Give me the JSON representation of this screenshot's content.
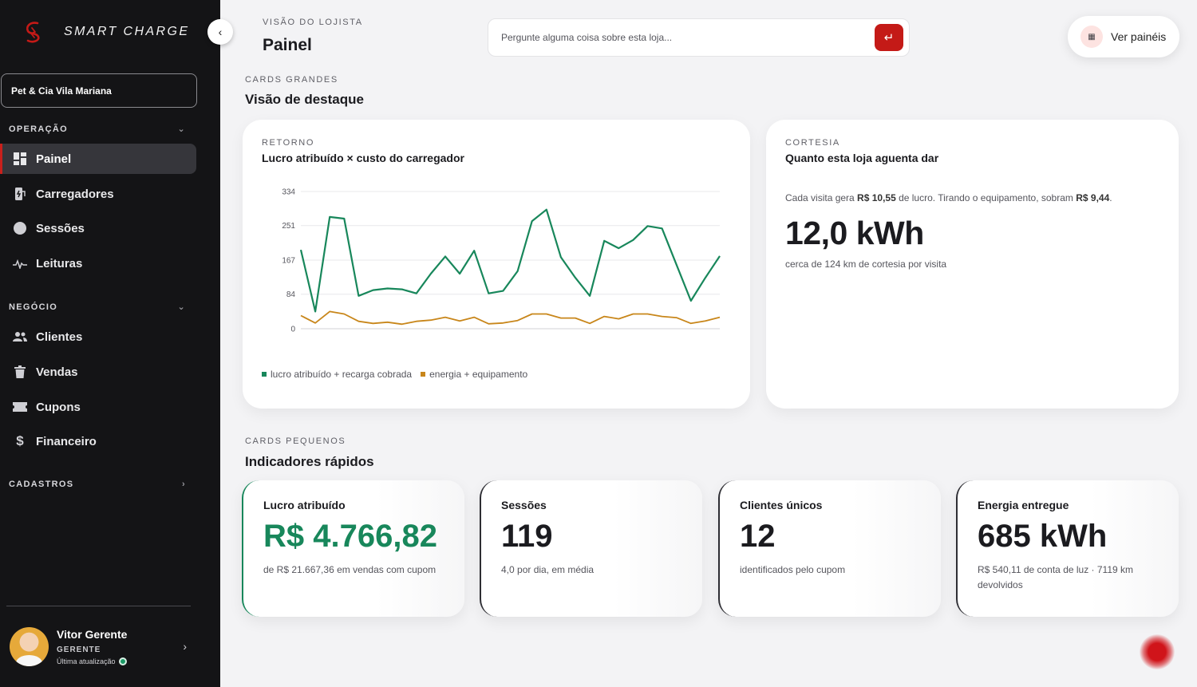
{
  "brand": {
    "name": "SMART CHARGE"
  },
  "sidebar": {
    "store": "Pet & Cia Vila Mariana",
    "sections": [
      {
        "label": "OPERAÇÃO",
        "items": [
          "Painel",
          "Carregadores",
          "Sessões",
          "Leituras"
        ]
      },
      {
        "label": "NEGÓCIO",
        "items": [
          "Clientes",
          "Vendas",
          "Cupons",
          "Financeiro"
        ]
      },
      {
        "label": "CADASTROS",
        "items": []
      }
    ],
    "active_item": "Painel"
  },
  "user": {
    "name": "Vitor Gerente",
    "role": "GERENTE",
    "update_label": "Última atualização"
  },
  "header": {
    "kicker": "VISÃO DO LOJISTA",
    "title": "Painel",
    "search_placeholder": "Pergunte alguma coisa sobre esta loja...",
    "panels_button": "Ver painéis"
  },
  "big_section": {
    "kicker": "CARDS GRANDES",
    "title": "Visão de destaque"
  },
  "small_section": {
    "kicker": "CARDS PEQUENOS",
    "title": "Indicadores rápidos"
  },
  "return_card": {
    "kicker": "RETORNO",
    "title": "Lucro atribuído × custo do carregador"
  },
  "courtesy_card": {
    "kicker": "CORTESIA",
    "title": "Quanto esta loja aguenta dar",
    "text_1": "Cada visita gera ",
    "profit": "R$ 10,55",
    "text_2": " de lucro. Tirando o equipamento, sobram ",
    "remaining": "R$ 9,44",
    "text_3": ".",
    "value": "12,0 kWh",
    "sub": "cerca de 124 km de cortesia por visita"
  },
  "kpis": [
    {
      "label": "Lucro atribuído",
      "value": "R$ 4.766,82",
      "sub": "de R$ 21.667,36 em vendas com cupom"
    },
    {
      "label": "Sessões",
      "value": "119",
      "sub": "4,0 por dia, em média"
    },
    {
      "label": "Clientes únicos",
      "value": "12",
      "sub": "identificados pelo cupom"
    },
    {
      "label": "Energia entregue",
      "value": "685 kWh",
      "sub": "R$ 540,11 de conta de luz · 7119 km devolvidos"
    }
  ],
  "colors": {
    "accent": "#c41a17",
    "green": "#18875b",
    "orange": "#c8861a"
  },
  "chart_data": {
    "type": "line",
    "y_ticks": [
      0,
      84,
      167,
      251,
      334
    ],
    "ylim": [
      0,
      334
    ],
    "x_count": 30,
    "grid": true,
    "legend_position": "bottom-left",
    "series": [
      {
        "name": "lucro atribuído + recarga cobrada",
        "color": "#18875b",
        "values": [
          192,
          42,
          272,
          268,
          80,
          94,
          98,
          96,
          86,
          134,
          176,
          134,
          190,
          86,
          92,
          140,
          262,
          290,
          174,
          124,
          80,
          214,
          196,
          216,
          250,
          244,
          156,
          68,
          124,
          177
        ]
      },
      {
        "name": "energia + equipamento",
        "color": "#c8861a",
        "values": [
          32,
          14,
          42,
          36,
          18,
          13,
          16,
          11,
          18,
          21,
          28,
          19,
          28,
          12,
          14,
          20,
          36,
          36,
          26,
          26,
          13,
          30,
          24,
          36,
          36,
          30,
          27,
          13,
          19,
          28
        ]
      }
    ]
  }
}
